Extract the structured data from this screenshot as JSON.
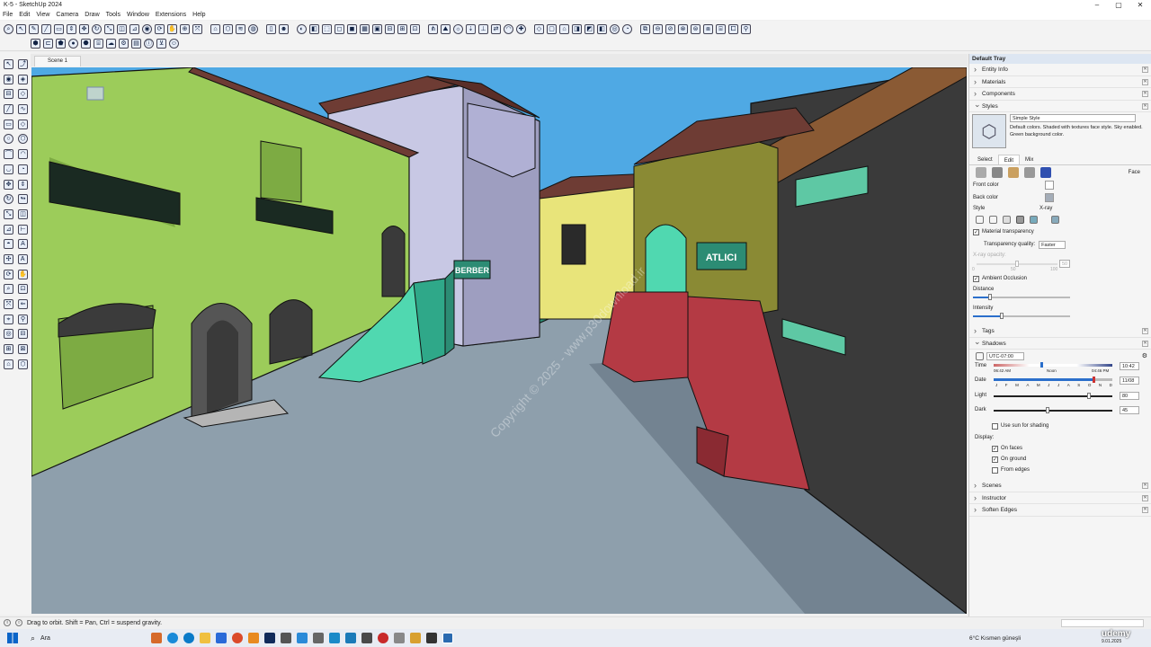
{
  "window": {
    "title": "K-5 - SketchUp 2024",
    "minimize": "–",
    "maximize": "▢",
    "close": "✕"
  },
  "menu": [
    "File",
    "Edit",
    "View",
    "Camera",
    "Draw",
    "Tools",
    "Window",
    "Extensions",
    "Help"
  ],
  "scene_tab": "Scene 1",
  "viewport": {
    "signs": {
      "barber": "BERBER",
      "shop": "ATLICI"
    },
    "watermark": "Copyright © 2025 - www.p30download.ir"
  },
  "status": {
    "hint": "Drag to orbit. Shift = Pan, Ctrl = suspend gravity."
  },
  "tray": {
    "title": "Default Tray",
    "sections_top": [
      "Entity Info",
      "Materials",
      "Components"
    ],
    "styles": {
      "label": "Styles",
      "name": "Simple Style",
      "description": "Default colors. Shaded with textures face style. Sky enabled. Green background color.",
      "tabs": [
        "Select",
        "Edit",
        "Mix"
      ],
      "active_tab": "Edit",
      "edit_label": "Face",
      "front_color_label": "Front color",
      "back_color_label": "Back color",
      "front_color": "#ffffff",
      "back_color": "#a4adb8",
      "style_label": "Style",
      "xray_label": "X-ray",
      "material_transparency": "Material transparency",
      "transparency_quality_label": "Transparency quality:",
      "transparency_quality": "Faster",
      "xray_opacity_label": "X-ray opacity:",
      "xray_ticks": [
        "0",
        "50",
        "100"
      ],
      "xray_value": "50",
      "ambient_occlusion": "Ambient Occlusion",
      "distance_label": "Distance",
      "distance_level": 0.18,
      "intensity_label": "Intensity",
      "intensity_level": 0.3
    },
    "tags": "Tags",
    "shadows": {
      "label": "Shadows",
      "timezone": "UTC-07:00",
      "time_label": "Time",
      "time_start": "06:42 AM",
      "time_noon": "Noon",
      "time_end": "04:46 PM",
      "time_value": "10:42",
      "date_label": "Date",
      "months": [
        "J",
        "F",
        "M",
        "A",
        "M",
        "J",
        "J",
        "A",
        "S",
        "O",
        "N",
        "D"
      ],
      "date_value": "11/08",
      "light_label": "Light",
      "light_value": "80",
      "dark_label": "Dark",
      "dark_value": "45",
      "use_sun": "Use sun for shading",
      "display_label": "Display:",
      "on_faces": "On faces",
      "on_ground": "On ground",
      "from_edges": "From edges"
    },
    "sections_bottom": [
      "Scenes",
      "Instructor",
      "Soften Edges"
    ]
  },
  "taskbar": {
    "search": "Ara",
    "weather": "6°C  Kısmen güneşli",
    "date": "9.01.2025",
    "brand": "udemy"
  },
  "colors": {
    "sky": "#4fa9e4",
    "ground": "#8e9fac",
    "green_wall": "#9ccc5a",
    "lavender_wall": "#c8c8e4",
    "yellow_wall": "#e8e47a",
    "red_stairs": "#b43a44",
    "teal": "#2c8c74",
    "roof": "#6e3c34",
    "accent": "#2b6fcb"
  }
}
